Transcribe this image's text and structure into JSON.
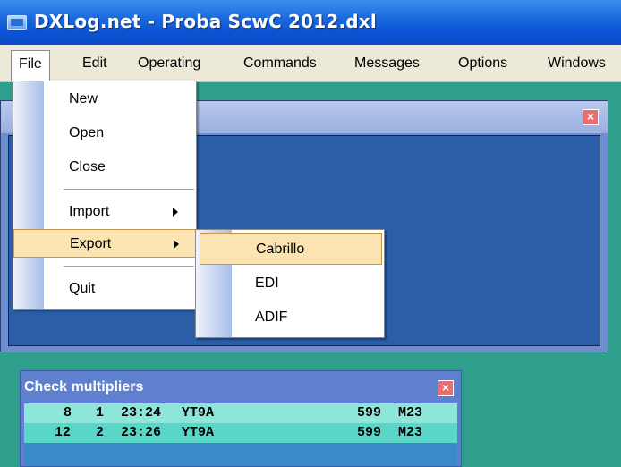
{
  "window": {
    "title": "DXLog.net - Proba ScwC 2012.dxl",
    "icon": "app-window-icon"
  },
  "menubar": {
    "items": [
      {
        "label": "File",
        "active": true
      },
      {
        "label": "Edit"
      },
      {
        "label": "Operating"
      },
      {
        "label": "Commands"
      },
      {
        "label": "Messages"
      },
      {
        "label": "Options"
      },
      {
        "label": "Windows"
      }
    ]
  },
  "file_menu": {
    "items": [
      {
        "label": "New"
      },
      {
        "label": "Open"
      },
      {
        "label": "Close"
      },
      {
        "label": "Import",
        "submenu": true
      },
      {
        "label": "Export",
        "submenu": true,
        "highlighted": true
      },
      {
        "label": "Quit"
      }
    ]
  },
  "export_submenu": {
    "items": [
      {
        "label": "Cabrillo",
        "highlighted": true
      },
      {
        "label": "EDI"
      },
      {
        "label": "ADIF"
      }
    ]
  },
  "check_multipliers": {
    "title": "Check multipliers",
    "rows": [
      {
        "qso": "8",
        "band": "1",
        "time": "23:24",
        "call": "YT9A",
        "rst": "599",
        "mult": "M23"
      },
      {
        "qso": "12",
        "band": "2",
        "time": "23:26",
        "call": "YT9A",
        "rst": "599",
        "mult": "M23"
      }
    ]
  },
  "colors": {
    "desktop": "#2f9e8c",
    "titlebar": "#0b53d6",
    "menu_highlight": "#fbe3b2",
    "panel_row_a": "#8ee5da",
    "panel_row_b": "#5ad6c8"
  }
}
